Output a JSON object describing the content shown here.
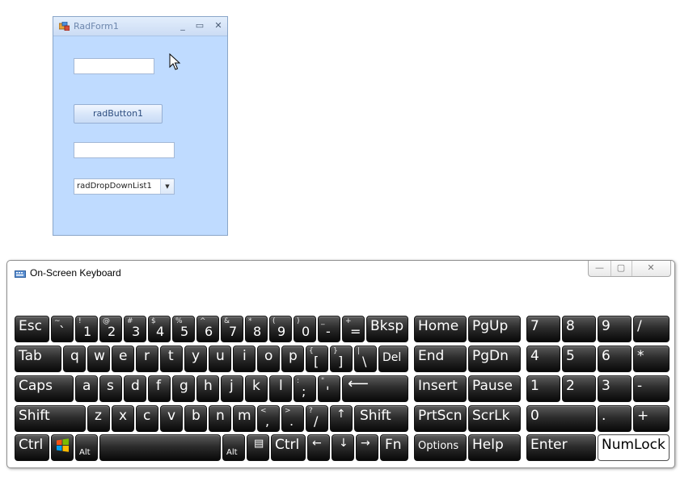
{
  "rad_form": {
    "title": "RadForm1",
    "minimize_glyph": "_",
    "maximize_glyph": "▭",
    "close_glyph": "✕",
    "button_label": "radButton1",
    "dropdown_value": "radDropDownList1",
    "dropdown_arrow": "▼",
    "textbox1_value": "",
    "textbox2_value": ""
  },
  "osk": {
    "title": "On-Screen Keyboard",
    "min_glyph": "—",
    "max_glyph": "▢",
    "close_glyph": "✕",
    "rows": {
      "row1": {
        "esc": "Esc",
        "k_backtick": {
          "sub": "~",
          "main": "`"
        },
        "k_1": {
          "sub": "!",
          "main": "1"
        },
        "k_2": {
          "sub": "@",
          "main": "2"
        },
        "k_3": {
          "sub": "#",
          "main": "3"
        },
        "k_4": {
          "sub": "$",
          "main": "4"
        },
        "k_5": {
          "sub": "%",
          "main": "5"
        },
        "k_6": {
          "sub": "^",
          "main": "6"
        },
        "k_7": {
          "sub": "&",
          "main": "7"
        },
        "k_8": {
          "sub": "*",
          "main": "8"
        },
        "k_9": {
          "sub": "(",
          "main": "9"
        },
        "k_0": {
          "sub": ")",
          "main": "0"
        },
        "k_minus": {
          "sub": "_",
          "main": "-"
        },
        "k_equal": {
          "sub": "+",
          "main": "="
        },
        "bksp": "Bksp",
        "home": "Home",
        "pgup": "PgUp",
        "num7": "7",
        "num8": "8",
        "num9": "9",
        "num_div": "/"
      },
      "row2": {
        "tab": "Tab",
        "q": "q",
        "w": "w",
        "e": "e",
        "r": "r",
        "t": "t",
        "y": "y",
        "u": "u",
        "i": "i",
        "o": "o",
        "p": "p",
        "k_lbracket": {
          "sub": "{",
          "main": "["
        },
        "k_rbracket": {
          "sub": "}",
          "main": "]"
        },
        "k_backslash": {
          "sub": "|",
          "main": "\\"
        },
        "del": "Del",
        "end": "End",
        "pgdn": "PgDn",
        "num4": "4",
        "num5": "5",
        "num6": "6",
        "num_mul": "*"
      },
      "row3": {
        "caps": "Caps",
        "a": "a",
        "s": "s",
        "d": "d",
        "f": "f",
        "g": "g",
        "h": "h",
        "j": "j",
        "k": "k",
        "l": "l",
        "k_semicolon": {
          "sub": ":",
          "main": ";"
        },
        "k_quote": {
          "sub": "\"",
          "main": "'"
        },
        "enter_arrow": "⟵",
        "insert": "Insert",
        "pause": "Pause",
        "num1": "1",
        "num2": "2",
        "num3": "3",
        "num_minus": "-"
      },
      "row4": {
        "shift_left": "Shift",
        "z": "z",
        "x": "x",
        "c": "c",
        "v": "v",
        "b": "b",
        "n": "n",
        "m": "m",
        "k_comma": {
          "sub": "<",
          "main": ","
        },
        "k_period": {
          "sub": ">",
          "main": "."
        },
        "k_slash": {
          "sub": "?",
          "main": "/"
        },
        "up": "↑",
        "shift_right": "Shift",
        "prtscn": "PrtScn",
        "scrlk": "ScrLk",
        "num0": "0",
        "num_dot": ".",
        "num_plus": "+"
      },
      "row5": {
        "ctrl_left": "Ctrl",
        "alt_left": "Alt",
        "space": "",
        "alt_right": "Alt",
        "menu_glyph": "▤",
        "ctrl_right": "Ctrl",
        "left": "←",
        "down": "↓",
        "right": "→",
        "fn": "Fn",
        "options": "Options",
        "help": "Help",
        "num_enter": "Enter",
        "numlock": "NumLock"
      }
    }
  }
}
